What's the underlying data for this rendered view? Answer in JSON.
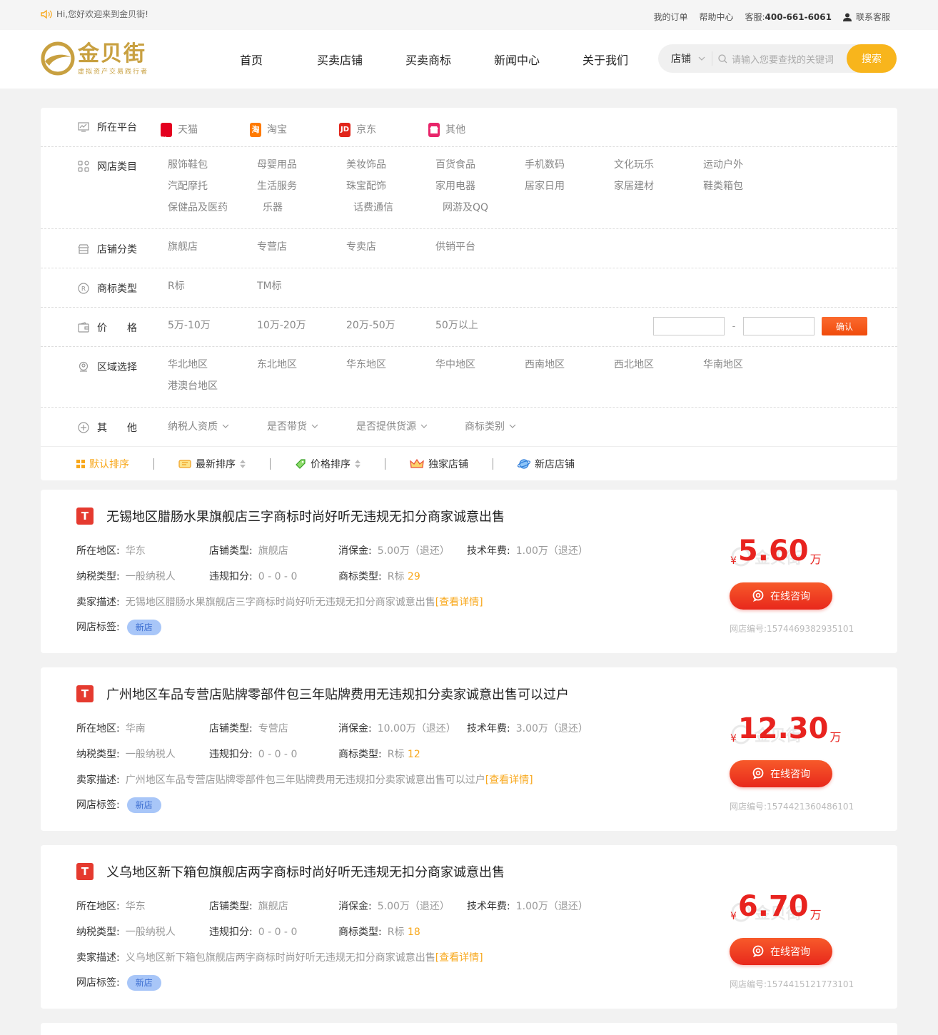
{
  "topbar": {
    "welcome": "Hi,您好欢迎来到金贝街!",
    "my_orders": "我的订单",
    "help": "帮助中心",
    "service_label": "客服:",
    "service_phone": "400-661-6061",
    "contact": "联系客服"
  },
  "logo": {
    "name": "金贝街",
    "slogan": "虚拟资产交易践行者"
  },
  "nav": [
    "首页",
    "买卖店铺",
    "买卖商标",
    "新闻中心",
    "关于我们"
  ],
  "search": {
    "category": "店铺",
    "placeholder": "请输入您要查找的关键词",
    "button": "搜索"
  },
  "filters": {
    "platform": {
      "label": "所在平台",
      "options": [
        "天猫",
        "淘宝",
        "京东",
        "其他"
      ]
    },
    "category": {
      "label": "网店类目",
      "options": [
        "服饰鞋包",
        "母婴用品",
        "美妆饰品",
        "百货食品",
        "手机数码",
        "文化玩乐",
        "运动户外",
        "汽配摩托",
        "生活服务",
        "珠宝配饰",
        "家用电器",
        "居家日用",
        "家居建材",
        "鞋类箱包",
        "保健品及医药",
        "乐器",
        "话费通信",
        "网游及QQ"
      ]
    },
    "shop_type": {
      "label": "店铺分类",
      "options": [
        "旗舰店",
        "专营店",
        "专卖店",
        "供销平台"
      ]
    },
    "trademark": {
      "label": "商标类型",
      "options": [
        "R标",
        "TM标"
      ]
    },
    "price": {
      "label": "价　　格",
      "options": [
        "5万-10万",
        "10万-20万",
        "20万-50万",
        "50万以上"
      ],
      "dash": "-",
      "confirm": "确认"
    },
    "region": {
      "label": "区域选择",
      "options": [
        "华北地区",
        "东北地区",
        "华东地区",
        "华中地区",
        "西南地区",
        "西北地区",
        "华南地区",
        "港澳台地区"
      ]
    },
    "other": {
      "label": "其　　他",
      "options": [
        "纳税人资质",
        "是否带货",
        "是否提供货源",
        "商标类别"
      ]
    }
  },
  "sort": [
    "默认排序",
    "最新排序",
    "价格排序",
    "独家店铺",
    "新店店铺"
  ],
  "field_labels": {
    "region": "所在地区:",
    "shop_type": "店铺类型:",
    "deposit": "消保金:",
    "tech_fee": "技术年费:",
    "tax": "纳税类型:",
    "penalty": "违规扣分:",
    "trademark": "商标类型:",
    "desc": "卖家描述:",
    "tags": "网店标签:",
    "detail": "[查看详情]",
    "consult": "在线咨询",
    "yen": "¥",
    "unit": "万",
    "code_label": "网店编号:"
  },
  "listings": [
    {
      "title": "无锡地区腊肠水果旗舰店三字商标时尚好听无违规无扣分商家诚意出售",
      "region": "华东",
      "shop_type": "旗舰店",
      "deposit": "5.00万（退还）",
      "tech_fee": "1.00万（退还）",
      "tax": "一般纳税人",
      "penalty": "0 - 0 - 0",
      "trademark": "R标",
      "trademark_class": "29",
      "desc": "无锡地区腊肠水果旗舰店三字商标时尚好听无违规无扣分商家诚意出售",
      "tag": "新店",
      "price": "5.60",
      "code": "1574469382935101"
    },
    {
      "title": "广州地区车品专营店贴牌零部件包三年贴牌费用无违规扣分卖家诚意出售可以过户",
      "region": "华南",
      "shop_type": "专营店",
      "deposit": "10.00万（退还）",
      "tech_fee": "3.00万（退还）",
      "tax": "一般纳税人",
      "penalty": "0 - 0 - 0",
      "trademark": "R标",
      "trademark_class": "12",
      "desc": "广州地区车品专营店贴牌零部件包三年贴牌费用无违规扣分卖家诚意出售可以过户",
      "tag": "新店",
      "price": "12.30",
      "code": "1574421360486101"
    },
    {
      "title": "义乌地区新下箱包旗舰店两字商标时尚好听无违规无扣分商家诚意出售",
      "region": "华东",
      "shop_type": "旗舰店",
      "deposit": "5.00万（退还）",
      "tech_fee": "1.00万（退还）",
      "tax": "一般纳税人",
      "penalty": "0 - 0 - 0",
      "trademark": "R标",
      "trademark_class": "18",
      "desc": "义乌地区新下箱包旗舰店两字商标时尚好听无违规无扣分商家诚意出售",
      "tag": "新店",
      "price": "6.70",
      "code": "1574415121773101"
    }
  ],
  "colors": {
    "accent": "#f8b51c",
    "price": "#e8231f",
    "consult": "#e8281c"
  }
}
